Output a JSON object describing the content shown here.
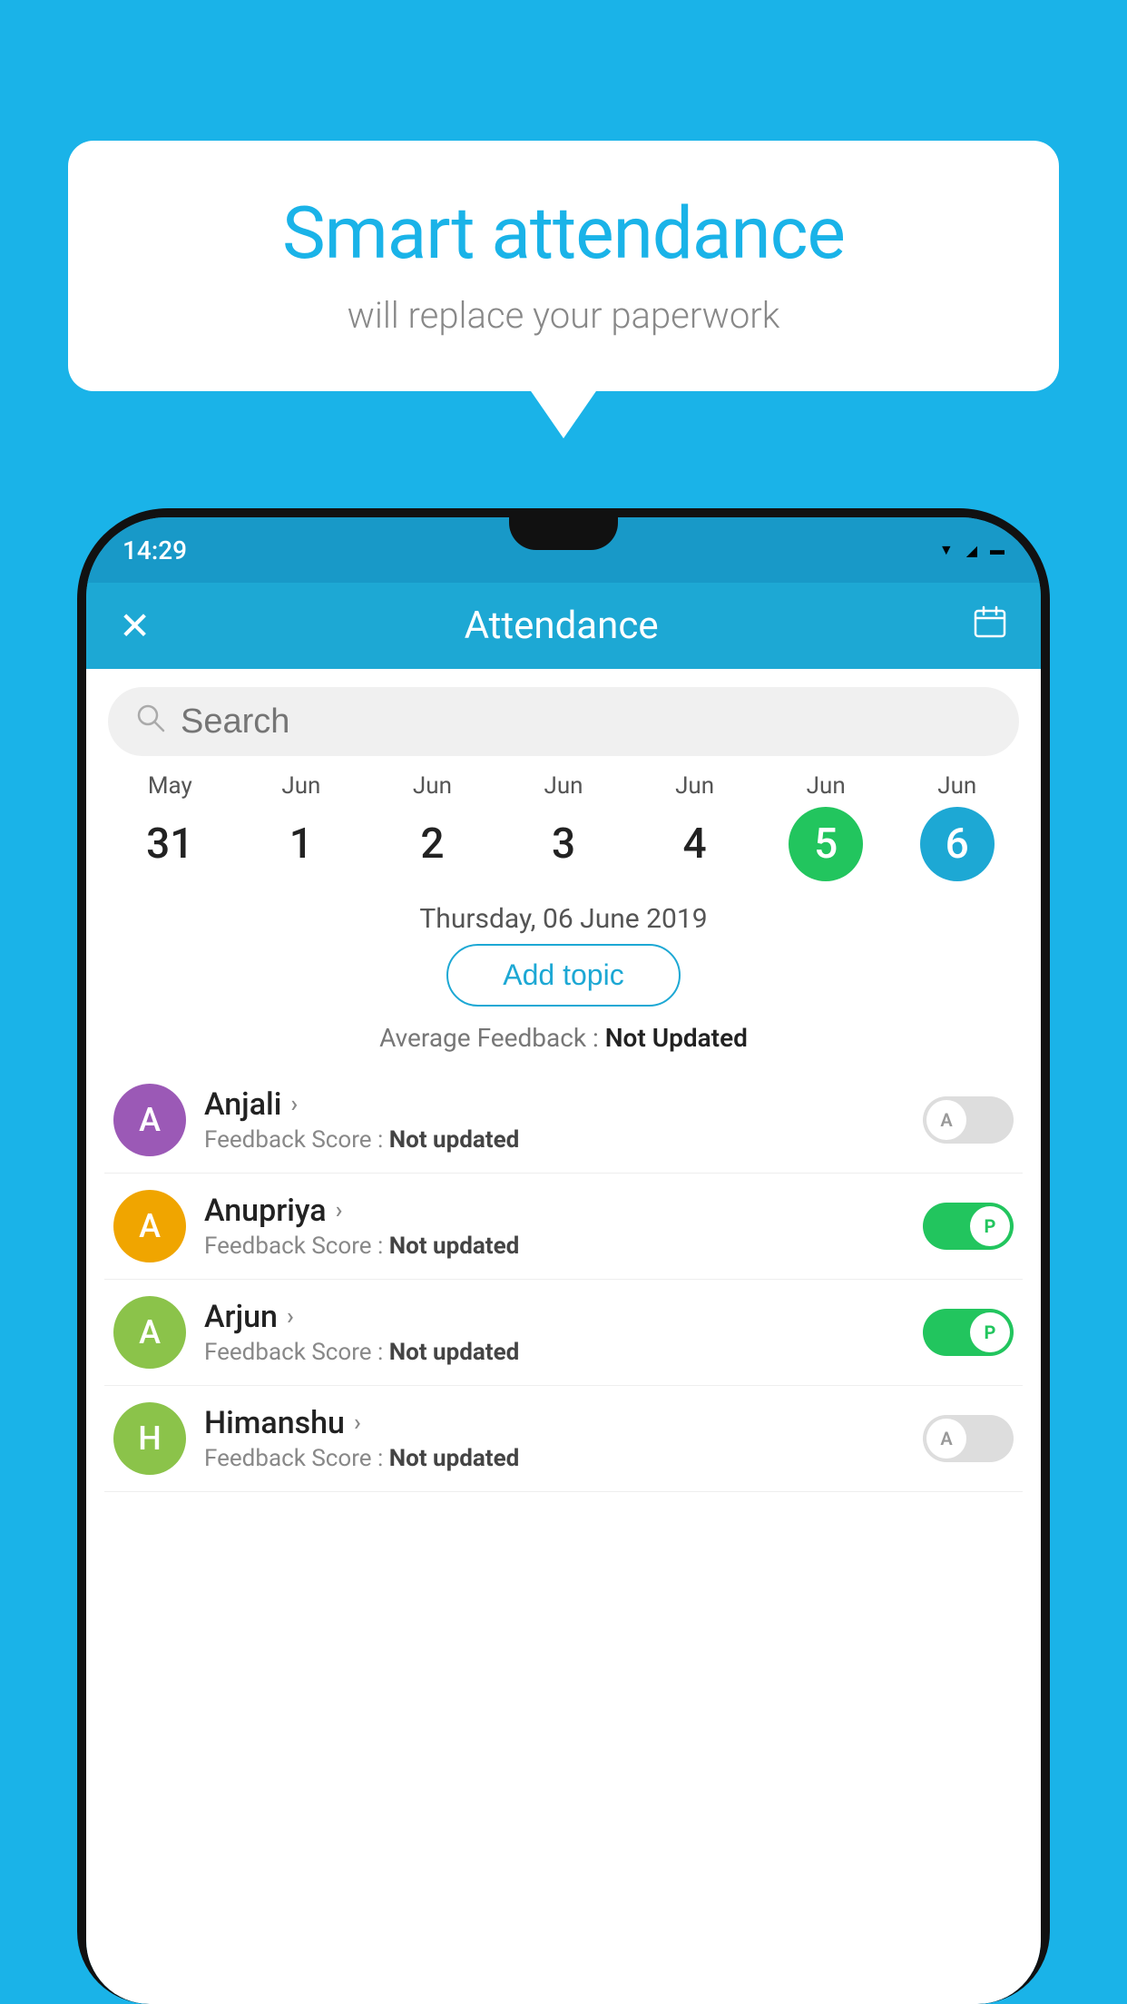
{
  "background": {
    "color": "#1ab3e8"
  },
  "speech_bubble": {
    "title": "Smart attendance",
    "subtitle": "will replace your paperwork"
  },
  "status_bar": {
    "time": "14:29",
    "wifi": "▲",
    "signal": "▲",
    "battery": "▌"
  },
  "top_bar": {
    "close_label": "✕",
    "title": "Attendance",
    "calendar_icon": "📅"
  },
  "search": {
    "placeholder": "Search"
  },
  "calendar": {
    "days": [
      {
        "month": "May",
        "date": "31",
        "state": "normal"
      },
      {
        "month": "Jun",
        "date": "1",
        "state": "normal"
      },
      {
        "month": "Jun",
        "date": "2",
        "state": "normal"
      },
      {
        "month": "Jun",
        "date": "3",
        "state": "normal"
      },
      {
        "month": "Jun",
        "date": "4",
        "state": "normal"
      },
      {
        "month": "Jun",
        "date": "5",
        "state": "today"
      },
      {
        "month": "Jun",
        "date": "6",
        "state": "selected"
      }
    ]
  },
  "selected_date": "Thursday, 06 June 2019",
  "add_topic_label": "Add topic",
  "average_feedback": {
    "label": "Average Feedback : ",
    "value": "Not Updated"
  },
  "students": [
    {
      "name": "Anjali",
      "initial": "A",
      "avatar_color": "#9b59b6",
      "feedback_label": "Feedback Score : ",
      "feedback_value": "Not updated",
      "toggle": "off",
      "toggle_letter": "A"
    },
    {
      "name": "Anupriya",
      "initial": "A",
      "avatar_color": "#f0a500",
      "feedback_label": "Feedback Score : ",
      "feedback_value": "Not updated",
      "toggle": "on",
      "toggle_letter": "P"
    },
    {
      "name": "Arjun",
      "initial": "A",
      "avatar_color": "#8bc34a",
      "feedback_label": "Feedback Score : ",
      "feedback_value": "Not updated",
      "toggle": "on",
      "toggle_letter": "P"
    },
    {
      "name": "Himanshu",
      "initial": "H",
      "avatar_color": "#8bc34a",
      "feedback_label": "Feedback Score : ",
      "feedback_value": "Not updated",
      "toggle": "off",
      "toggle_letter": "A"
    }
  ]
}
